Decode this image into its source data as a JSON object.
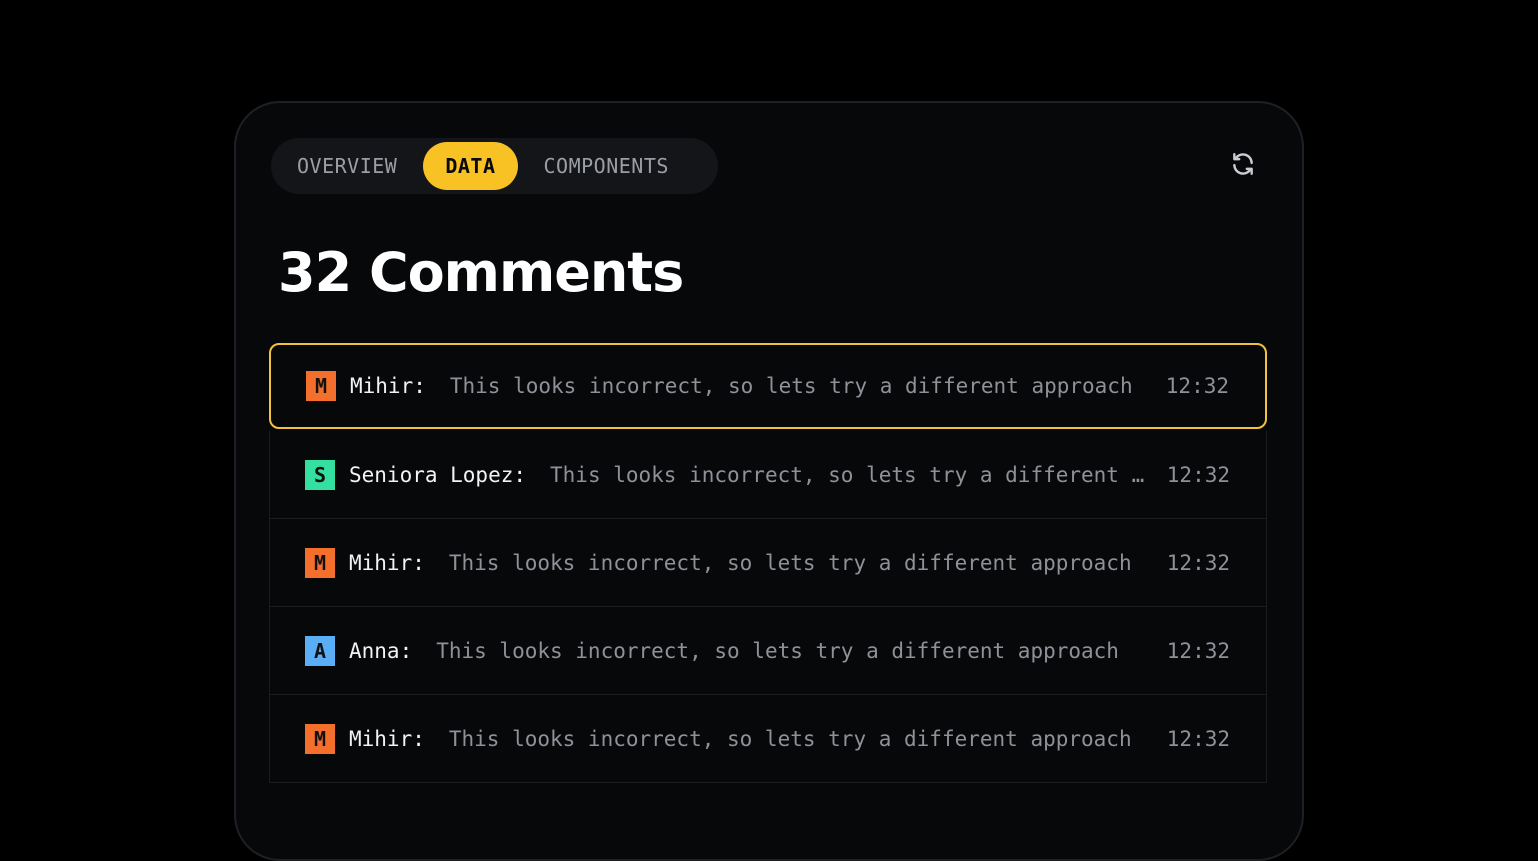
{
  "tabs": [
    {
      "label": "OVERVIEW",
      "active": false
    },
    {
      "label": "DATA",
      "active": true
    },
    {
      "label": "COMPONENTS",
      "active": false
    }
  ],
  "toolbar": {
    "refresh_icon": "refresh-icon"
  },
  "page_title": "32 Comments",
  "comments": [
    {
      "initial": "M",
      "author": "Mihir:",
      "text": "This looks incorrect, so lets try a different approach",
      "time": "12:32",
      "color": "#f56f2c",
      "selected": true
    },
    {
      "initial": "S",
      "author": "Seniora Lopez:",
      "text": "This looks incorrect, so lets try a different approach",
      "time": "12:32",
      "color": "#34e0a1",
      "selected": false
    },
    {
      "initial": "M",
      "author": "Mihir:",
      "text": "This looks incorrect, so lets try a different approach",
      "time": "12:32",
      "color": "#f56f2c",
      "selected": false
    },
    {
      "initial": "A",
      "author": "Anna:",
      "text": "This looks incorrect, so lets try a different approach",
      "time": "12:32",
      "color": "#5aaef5",
      "selected": false
    },
    {
      "initial": "M",
      "author": "Mihir:",
      "text": "This looks incorrect, so lets try a different approach",
      "time": "12:32",
      "color": "#f56f2c",
      "selected": false
    }
  ],
  "colors": {
    "accent": "#f8c124",
    "background": "#07080a"
  }
}
